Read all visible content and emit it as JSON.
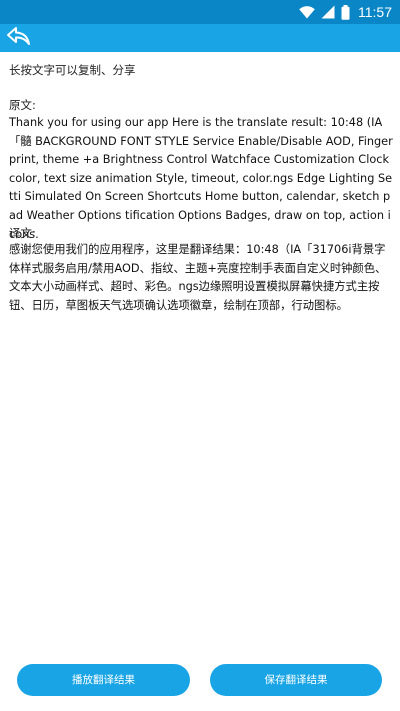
{
  "status_bar": {
    "time": "11:57",
    "icons": [
      "wifi-icon",
      "cellular-signal-icon",
      "battery-icon"
    ]
  },
  "toolbar": {
    "back_icon": "back-arrow-icon"
  },
  "hint": "长按文字可以复制、分享",
  "original": {
    "label": "原文:",
    "text": "Thank you for using our app Here is the translate result: 10:48 (IA「髓 BACKGROUND FONT STYLE Service Enable/Disable AOD, Fingerprint, theme +a Brightness Control Watchface Customization Clock color, text size animation Style, timeout, color.ngs Edge Lighting Setti Simulated On Screen Shortcuts Home button, calendar, sketch pad Weather Options tification Options Badges, draw on top, action icons."
  },
  "translation": {
    "label": "译文:",
    "text": "感谢您使用我们的应用程序，这里是翻译结果：10:48（IA「31706i背景字体样式服务启用/禁用AOD、指纹、主题+亮度控制手表面自定义时钟颜色、文本大小动画样式、超时、彩色。ngs边缘照明设置模拟屏幕快捷方式主按钮、日历，草图板天气选项确认选项徽章，绘制在顶部，行动图标。"
  },
  "buttons": {
    "play": "播放翻译结果",
    "save": "保存翻译结果"
  },
  "colors": {
    "status_bar": "#0a86c6",
    "toolbar": "#18a4e5",
    "button": "#18a4e5"
  }
}
